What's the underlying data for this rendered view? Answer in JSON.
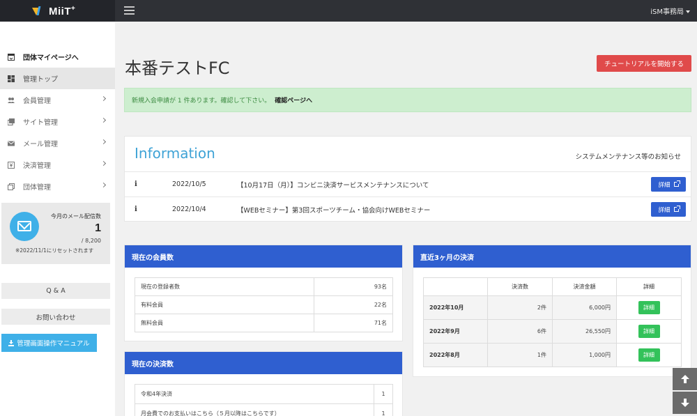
{
  "header": {
    "logo_text": "MiiT",
    "logo_sup": "+",
    "user_name": "iSM事務局"
  },
  "sidebar": {
    "items": [
      {
        "label": "団体マイページへ",
        "icon": "external-page-icon"
      },
      {
        "label": "管理トップ",
        "icon": "dashboard-icon"
      },
      {
        "label": "会員管理",
        "icon": "users-icon"
      },
      {
        "label": "サイト管理",
        "icon": "site-icon"
      },
      {
        "label": "メール管理",
        "icon": "mail-icon"
      },
      {
        "label": "決済管理",
        "icon": "payment-icon"
      },
      {
        "label": "団体管理",
        "icon": "organization-icon"
      }
    ],
    "mail_stats": {
      "label": "今月のメール配信数",
      "count": "1",
      "total": "/ 8,200",
      "reset_note": "※2022/11/1にリセットされます"
    },
    "qa_label": "Q & A",
    "contact_label": "お問い合わせ",
    "manual_label": "管理画面操作マニュアル"
  },
  "main": {
    "title": "本番テストFC",
    "tutorial_label": "チュートリアルを開始する",
    "alert_text": "新規入会申請が 1 件あります。確認して下さい。",
    "alert_link": "確認ページへ",
    "information": {
      "title": "Information",
      "subtitle": "システムメンテナンス等のお知らせ",
      "detail_label": "詳細",
      "rows": [
        {
          "icon": "i",
          "date": "2022/10/5",
          "text": "【10月17日（月）】コンビニ決済サービスメンテナンスについて"
        },
        {
          "icon": "i",
          "date": "2022/10/4",
          "text": "【WEBセミナー】第3回スポーツチーム・協会向けWEBセミナー"
        }
      ]
    },
    "members": {
      "title": "現在の会員数",
      "rows": [
        {
          "label": "現在の登録者数",
          "value": "93名"
        },
        {
          "label": "有料会員",
          "value": "22名"
        },
        {
          "label": "無料会員",
          "value": "71名"
        }
      ]
    },
    "payments": {
      "title": "現在の決済数",
      "rows": [
        {
          "label": "令和4年決済",
          "value": "1"
        },
        {
          "label": "月会費でのお支払いはこちら（５月以降はこちらです）",
          "value": "1"
        }
      ]
    },
    "recent": {
      "title": "直近3ヶ月の決済",
      "headers": [
        "",
        "決済数",
        "決済金額",
        "詳細"
      ],
      "detail_label": "詳細",
      "rows": [
        {
          "month": "2022年10月",
          "count": "2件",
          "amount": "6,000円"
        },
        {
          "month": "2022年9月",
          "count": "6件",
          "amount": "26,550円"
        },
        {
          "month": "2022年8月",
          "count": "1件",
          "amount": "1,000円"
        }
      ]
    }
  }
}
